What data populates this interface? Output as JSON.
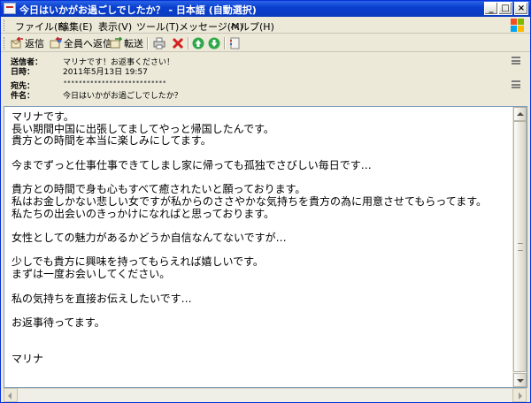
{
  "window": {
    "title": "今日はいかがお過ごしでしたか？ - 日本語 (自動選択)",
    "controls": {
      "minimize": "_",
      "maximize": "□",
      "close": "×"
    }
  },
  "menubar": {
    "items": [
      {
        "label": "ファイル(F)"
      },
      {
        "label": "編集(E)"
      },
      {
        "label": "表示(V)"
      },
      {
        "label": "ツール(T)"
      },
      {
        "label": "メッセージ(M)"
      },
      {
        "label": "ヘルプ(H)"
      }
    ]
  },
  "toolbar": {
    "reply_label": "返信",
    "reply_all_label": "全員へ返信",
    "forward_label": "転送",
    "icons": [
      "print-icon",
      "delete-icon",
      "previous-icon",
      "next-icon",
      "addresses-icon"
    ]
  },
  "header": {
    "from_label": "送信者：",
    "from_value": "マリナです！お返事ください！",
    "date_label": "日時：",
    "date_value": "2011年5月13日 19:57",
    "to_label": "宛先：",
    "to_value": "•••••••••••••••••••••••••••",
    "subject_label": "件名：",
    "subject_value": "今日はいかがお過ごしでしたか？"
  },
  "body": {
    "text": "マリナです。\n長い期間中国に出張してましてやっと帰国したんです。\n貴方との時間を本当に楽しみにしてます。\n\n今までずっと仕事仕事できてしまし家に帰っても孤独でさびしい毎日です…\n\n貴方との時間で身も心もすべて癒されたいと願っております。\n私はお金しかない悲しい女ですが私からのささやかな気持ちを貴方の為に用意させてもらってます。\n私たちの出会いのきっかけになればと思っております。\n\n女性としての魅力があるかどうか自信なんてないですが…\n\n少しでも貴方に興味を持ってもらえれば嬉しいです。\nまずは一度お会いしてください。\n\n私の気持ちを直接お伝えしたいです…\n\nお返事待ってます。\n\n\nマリナ"
  },
  "colors": {
    "titlebar": "#0a3fcf",
    "chrome": "#ece9d8",
    "border": "#7f9db9"
  }
}
